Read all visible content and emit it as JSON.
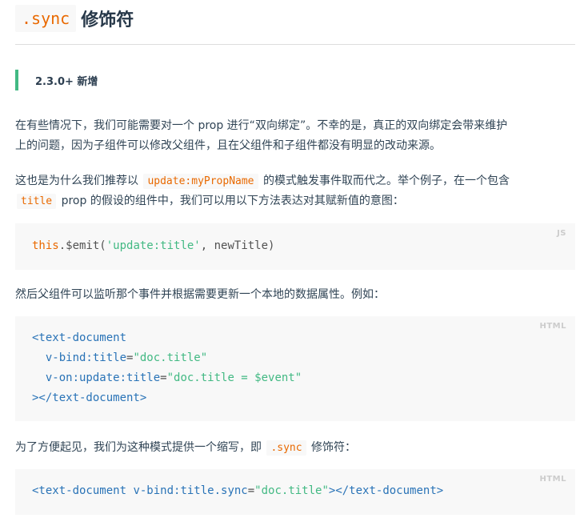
{
  "heading": {
    "code": ".sync",
    "text": "修饰符"
  },
  "callout": {
    "text": "2.3.0+ 新增"
  },
  "para1": {
    "line1": "在有些情况下，我们可能需要对一个 prop 进行“双向绑定”。不幸的是，真正的双向绑定会带来维护",
    "line2": "上的问题，因为子组件可以修改父组件，且在父组件和子组件都没有明显的改动来源。"
  },
  "para2": {
    "pre": "这也是为什么我们推荐以",
    "code1": "update:myPropName",
    "mid": "的模式触发事件取而代之。举个例子，在一个包含",
    "code2": "title",
    "post": "prop 的假设的组件中，我们可以用以下方法表达对其赋新值的意图："
  },
  "code_js": {
    "lang": "JS",
    "kw": "this",
    "method": ".$emit(",
    "str": "'update:title'",
    "rest": ", newTitle)"
  },
  "para3": {
    "text": "然后父组件可以监听那个事件并根据需要更新一个本地的数据属性。例如："
  },
  "code_html1": {
    "lang": "HTML",
    "l1_tag": "<text-document",
    "l2_attr": "  v-bind:title",
    "l2_eq": "=",
    "l2_val": "\"doc.title\"",
    "l3_attr": "  v-on:update:title",
    "l3_eq": "=",
    "l3_val": "\"doc.title = $event\"",
    "l4_tag": "></text-document>"
  },
  "para4": {
    "pre": "为了方便起见，我们为这种模式提供一个缩写，即",
    "code": ".sync",
    "post": "修饰符："
  },
  "code_html2": {
    "lang": "HTML",
    "tag_open": "<text-document ",
    "attr": "v-bind:title.sync",
    "eq": "=",
    "val": "\"doc.title\"",
    "tag_close": "></text-document>"
  }
}
